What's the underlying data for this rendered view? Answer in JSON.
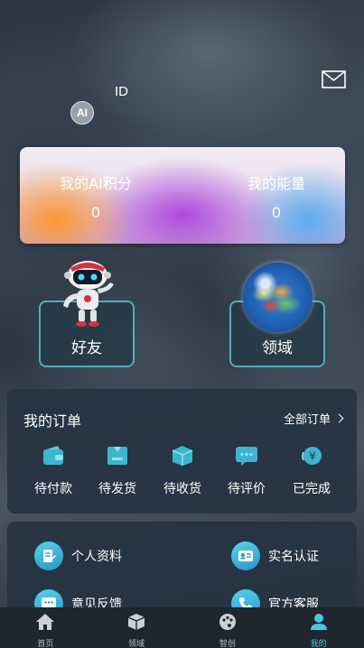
{
  "status_bar": {
    "time": "4:20"
  },
  "profile": {
    "id_label": "ID",
    "avatar_text": "AI"
  },
  "points_card": {
    "left_label": "我的AI积分",
    "left_value": "0",
    "right_label": "我的能量",
    "right_value": "0"
  },
  "feature_buttons": {
    "friends": "好友",
    "domain": "领域"
  },
  "orders": {
    "title": "我的订单",
    "all_label": "全部订单",
    "items": [
      {
        "label": "待付款",
        "icon": "wallet-icon"
      },
      {
        "label": "待发货",
        "icon": "package-out-icon"
      },
      {
        "label": "待收货",
        "icon": "box-icon"
      },
      {
        "label": "待评价",
        "icon": "comment-icon"
      },
      {
        "label": "已完成",
        "icon": "yuan-icon"
      }
    ]
  },
  "menu": {
    "items": [
      {
        "label": "个人资料",
        "icon": "profile-edit-icon"
      },
      {
        "label": "实名认证",
        "icon": "id-card-icon"
      },
      {
        "label": "意见反馈",
        "icon": "feedback-icon"
      },
      {
        "label": "官方客服",
        "icon": "phone-icon"
      }
    ]
  },
  "tabbar": {
    "items": [
      {
        "label": "首页",
        "icon": "home-icon"
      },
      {
        "label": "领域",
        "icon": "cube-icon"
      },
      {
        "label": "智创",
        "icon": "palette-icon"
      },
      {
        "label": "我的",
        "icon": "user-icon"
      }
    ],
    "active_index": 3,
    "accent": "#43c8e3"
  }
}
